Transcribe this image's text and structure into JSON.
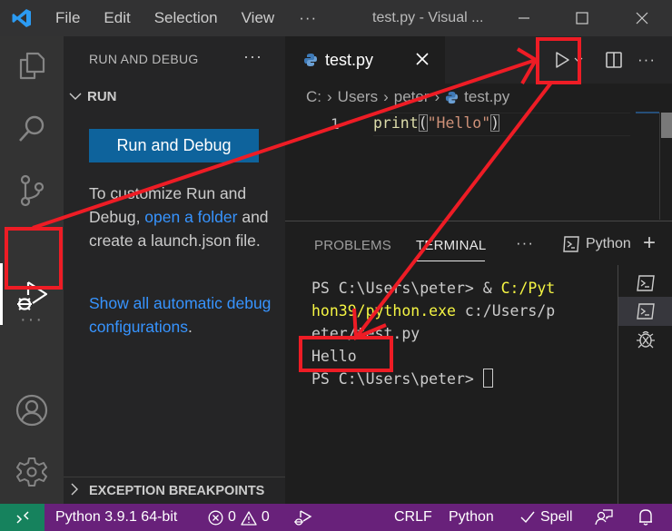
{
  "titlebar": {
    "menu": [
      "File",
      "Edit",
      "Selection",
      "View"
    ],
    "more": "···",
    "window_title": "test.py - Visual ..."
  },
  "activitybar": {
    "items": [
      "explorer-icon",
      "search-icon",
      "source-control-icon",
      "run-debug-icon",
      "more-icon",
      "accounts-icon",
      "settings-gear-icon"
    ],
    "more": "···",
    "active": "run-debug-icon"
  },
  "sidebar": {
    "title": "RUN AND DEBUG",
    "more": "···",
    "section": "RUN",
    "run_button": "Run and Debug",
    "text_pre": "To customize Run and Debug, ",
    "text_link": "open a folder",
    "text_post": " and create a launch.json file.",
    "link2": "Show all automatic debug configurations",
    "link2_suffix": ".",
    "exception_section": "EXCEPTION BREAKPOINTS"
  },
  "editor": {
    "tab_label": "test.py",
    "breadcrumb": [
      "C:",
      "Users",
      "peter",
      "test.py"
    ],
    "lines": [
      {
        "num": "1",
        "fn": "print",
        "open": "(",
        "str": "\"Hello\"",
        "close": ")"
      }
    ]
  },
  "panel": {
    "tabs": [
      "PROBLEMS",
      "TERMINAL"
    ],
    "active_tab": "TERMINAL",
    "more": "···",
    "terminal_name": "Python",
    "add": "+",
    "terminal": {
      "l1_prompt": "PS C:\\Users\\peter> & ",
      "l1_path": "C:/Pyt",
      "l2_path": "hon39/python.exe",
      "l2_rest": " c:/Users/p",
      "l3": "eter/test.py",
      "l4": "Hello",
      "l5_prompt": "PS C:\\Users\\peter> "
    }
  },
  "statusbar": {
    "interpreter": "Python 3.9.1 64-bit",
    "errors": "0",
    "warnings": "0",
    "eol": "CRLF",
    "language": "Python",
    "spell": "Spell",
    "colors": {
      "background": "#68217a",
      "remote": "#16825d"
    }
  },
  "annotations": {
    "color": "#ee1c25"
  }
}
